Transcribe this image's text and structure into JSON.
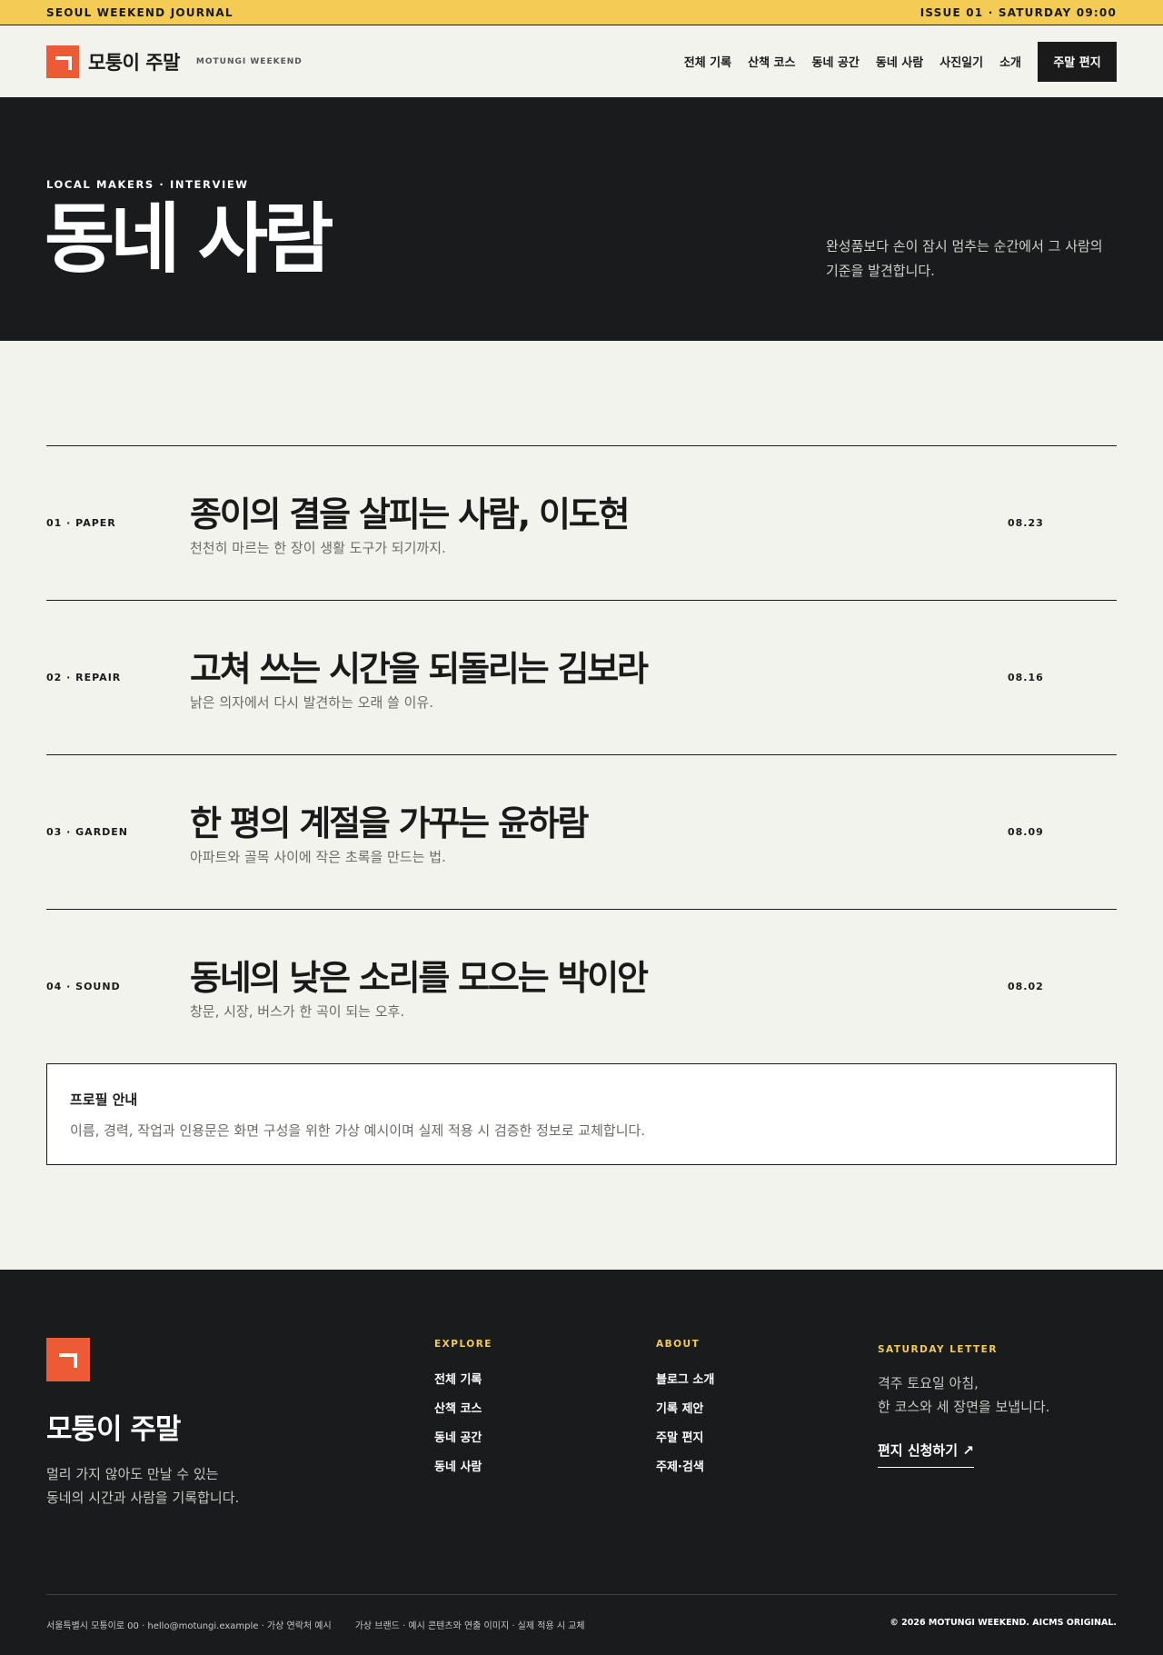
{
  "topbar": {
    "left": "SEOUL WEEKEND JOURNAL",
    "right": "ISSUE 01 · SATURDAY 09:00"
  },
  "header": {
    "brand_name": "모퉁이 주말",
    "brand_sub": "MOTUNGI WEEKEND",
    "nav": [
      "전체 기록",
      "산책 코스",
      "동네 공간",
      "동네 사람",
      "사진일기",
      "소개"
    ],
    "cta": "주말 편지"
  },
  "hero": {
    "eyebrow": "LOCAL MAKERS · INTERVIEW",
    "title": "동네 사람",
    "description_line1": "완성품보다 손이 잠시 멈추는 순간에서 그 사람의",
    "description_line2": "기준을 발견합니다."
  },
  "articles": [
    {
      "tag": "01 · PAPER",
      "title": "종이의 결을 살피는 사람, 이도현",
      "subtitle": "천천히 마르는 한 장이 생활 도구가 되기까지.",
      "date": "08.23"
    },
    {
      "tag": "02 · REPAIR",
      "title": "고쳐 쓰는 시간을 되돌리는 김보라",
      "subtitle": "낡은 의자에서 다시 발견하는 오래 쓸 이유.",
      "date": "08.16"
    },
    {
      "tag": "03 · GARDEN",
      "title": "한 평의 계절을 가꾸는 윤하람",
      "subtitle": "아파트와 골목 사이에 작은 초록을 만드는 법.",
      "date": "08.09"
    },
    {
      "tag": "04 · SOUND",
      "title": "동네의 낮은 소리를 모으는 박이안",
      "subtitle": "창문, 시장, 버스가 한 곡이 되는 오후.",
      "date": "08.02"
    }
  ],
  "note": {
    "title": "프로필 안내",
    "body": "이름, 경력, 작업과 인용문은 화면 구성을 위한 가상 예시이며 실제 적용 시 검증한 정보로 교체합니다."
  },
  "footer": {
    "brand_name": "모퉁이 주말",
    "desc_line1": "멀리 가지 않아도 만날 수 있는",
    "desc_line2": "동네의 시간과 사람을 기록합니다.",
    "explore": {
      "head": "EXPLORE",
      "items": [
        "전체 기록",
        "산책 코스",
        "동네 공간",
        "동네 사람"
      ]
    },
    "about": {
      "head": "ABOUT",
      "items": [
        "블로그 소개",
        "기록 제안",
        "주말 편지",
        "주제·검색"
      ]
    },
    "letter": {
      "head": "SATURDAY LETTER",
      "line1": "격주 토요일 아침,",
      "line2": "한 코스와 세 장면을 보냅니다.",
      "link": "편지 신청하기 ↗"
    },
    "bottom_left_1": "서울특별시 모퉁이로 00 · hello@motungi.example · 가상 연락처 예시",
    "bottom_left_2": "가상 브랜드 · 예시 콘텐츠와 연출 이미지 · 실제 적용 시 교체",
    "bottom_right": "© 2026 MOTUNGI WEEKEND. AICMS ORIGINAL."
  },
  "colors": {
    "accent_yellow": "#f4cb55",
    "accent_orange": "#ed5a36",
    "dark": "#1a1b1d"
  }
}
